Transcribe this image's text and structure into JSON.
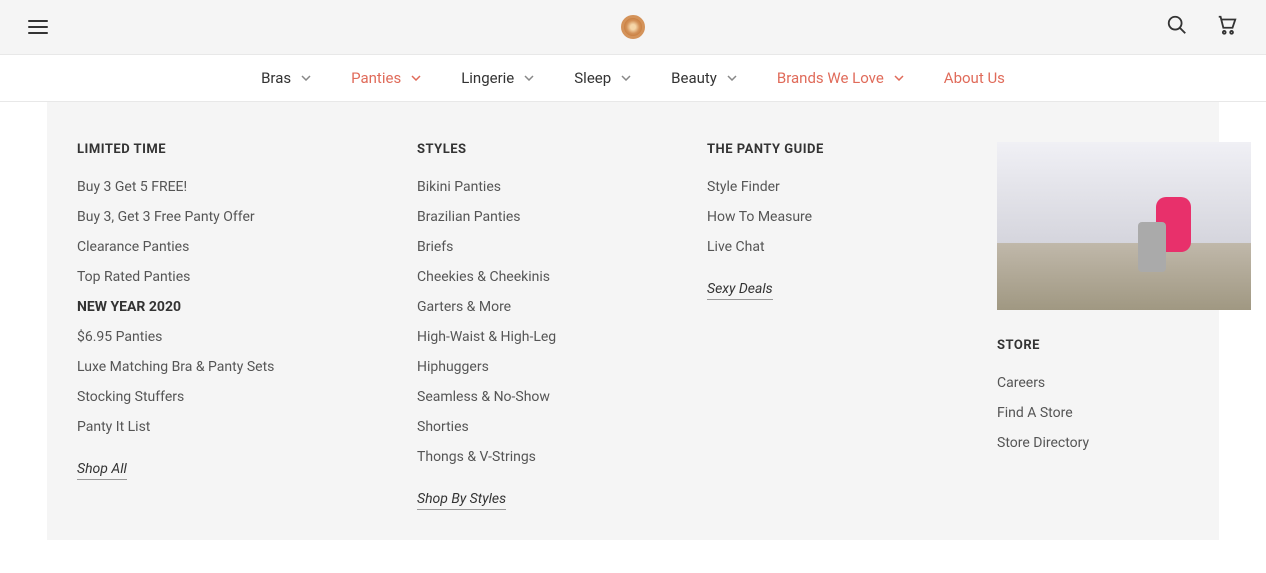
{
  "nav": {
    "items": [
      {
        "label": "Bras",
        "accent": false,
        "hasDropdown": true
      },
      {
        "label": "Panties",
        "accent": true,
        "hasDropdown": true
      },
      {
        "label": "Lingerie",
        "accent": false,
        "hasDropdown": true
      },
      {
        "label": "Sleep",
        "accent": false,
        "hasDropdown": true
      },
      {
        "label": "Beauty",
        "accent": false,
        "hasDropdown": true
      },
      {
        "label": "Brands We Love",
        "accent": true,
        "hasDropdown": true
      },
      {
        "label": "About Us",
        "accent": true,
        "hasDropdown": false
      }
    ]
  },
  "megaMenu": {
    "limitedTime": {
      "heading": "LIMITED TIME",
      "links1": [
        "Buy 3 Get 5 FREE!",
        "Buy 3, Get 3 Free Panty Offer",
        "Clearance Panties",
        "Top Rated Panties"
      ],
      "subheading": "NEW YEAR 2020",
      "links2": [
        "$6.95 Panties",
        "Luxe Matching Bra & Panty Sets",
        "Stocking Stuffers",
        "Panty It List"
      ],
      "cta": "Shop All"
    },
    "styles": {
      "heading": "STYLES",
      "links": [
        "Bikini Panties",
        "Brazilian Panties",
        "Briefs",
        "Cheekies & Cheekinis",
        "Garters & More",
        "High-Waist & High-Leg",
        "Hiphuggers",
        "Seamless & No-Show",
        "Shorties",
        "Thongs & V-Strings"
      ],
      "cta": "Shop By Styles"
    },
    "pantyGuide": {
      "heading": "THE PANTY GUIDE",
      "links": [
        "Style Finder",
        "How To Measure",
        "Live Chat"
      ],
      "cta": "Sexy Deals"
    },
    "store": {
      "heading": "STORE",
      "links": [
        "Careers",
        "Find A Store",
        "Store Directory"
      ]
    }
  },
  "colors": {
    "accent": "#e06b5a"
  }
}
